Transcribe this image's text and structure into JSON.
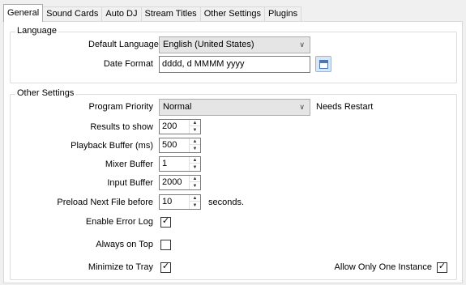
{
  "tabs": [
    {
      "label": "General",
      "active": true
    },
    {
      "label": "Sound Cards",
      "active": false
    },
    {
      "label": "Auto DJ",
      "active": false
    },
    {
      "label": "Stream Titles",
      "active": false
    },
    {
      "label": "Other Settings",
      "active": false
    },
    {
      "label": "Plugins",
      "active": false
    }
  ],
  "language": {
    "title": "Language",
    "default_language_label": "Default Language",
    "default_language_value": "English (United States)",
    "date_format_label": "Date Format",
    "date_format_value": "dddd, d MMMM yyyy",
    "date_picker_icon": "calendar-icon"
  },
  "other": {
    "title": "Other Settings",
    "program_priority_label": "Program Priority",
    "program_priority_value": "Normal",
    "needs_restart": "Needs Restart",
    "results_label": "Results to show",
    "results_value": "200",
    "playback_label": "Playback Buffer (ms)",
    "playback_value": "500",
    "mixer_label": "Mixer Buffer",
    "mixer_value": "1",
    "input_label": "Input Buffer",
    "input_value": "2000",
    "preload_label": "Preload Next File before",
    "preload_value": "10",
    "preload_suffix": "seconds.",
    "error_log_label": "Enable Error Log",
    "error_log_checked": true,
    "always_top_label": "Always on Top",
    "always_top_checked": false,
    "minimize_label": "Minimize to Tray",
    "minimize_checked": true,
    "one_instance_label": "Allow Only One Instance",
    "one_instance_checked": true
  },
  "glyphs": {
    "dropdown": "∨",
    "up": "▲",
    "down": "▼",
    "check": "✓"
  }
}
